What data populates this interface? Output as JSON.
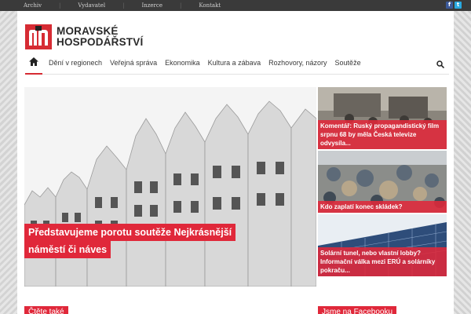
{
  "topbar": {
    "links": [
      "Archiv",
      "Vydavatel",
      "Inzerce",
      "Kontakt"
    ],
    "social": {
      "facebook": "f",
      "twitter": "t"
    }
  },
  "logo": {
    "line1": "MORAVSKÉ",
    "line2": "HOSPODÁŘSTVÍ",
    "mark_letter": "m",
    "brand_color": "#d62b33"
  },
  "nav": {
    "home_icon": "home-icon",
    "items": [
      "Dění v regionech",
      "Veřejná správa",
      "Ekonomika",
      "Kultura a zábava",
      "Rozhovory, názory",
      "Soutěže"
    ],
    "search_icon": "search-icon"
  },
  "hero": {
    "caption_line1": "Představujeme porotu soutěže Nejkrásnější",
    "caption_line2": "náměstí či náves"
  },
  "thumbs": [
    {
      "caption": "Komentář: Ruský propagandistický film srpnu 68 by měla Česká televize odvysíla..."
    },
    {
      "caption": "Kdo zaplatí konec skládek?"
    },
    {
      "caption": "Solární tunel, nebo vlastní lobby? Informační válka mezi ERÚ a solárníky pokraču..."
    }
  ],
  "sections": {
    "read_also": "Čtěte také",
    "facebook": "Jsme na Facebooku"
  },
  "colors": {
    "accent": "#e0283a",
    "topbar": "#3a3a3a"
  }
}
